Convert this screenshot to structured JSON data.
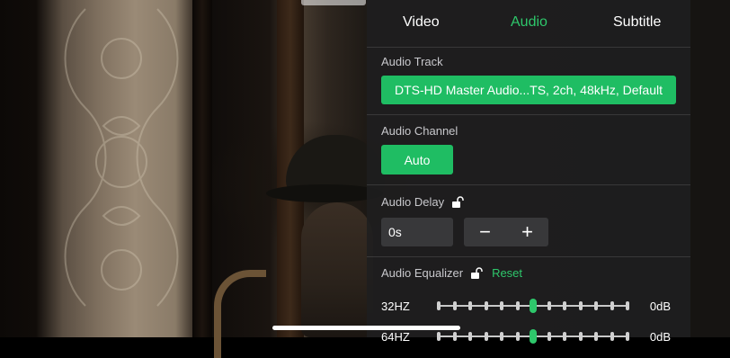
{
  "tabs": [
    {
      "label": "Video",
      "active": false
    },
    {
      "label": "Audio",
      "active": true
    },
    {
      "label": "Subtitle",
      "active": false
    }
  ],
  "audio_track": {
    "label": "Audio Track",
    "value": "DTS-HD Master Audio...TS, 2ch, 48kHz, Default"
  },
  "audio_channel": {
    "label": "Audio Channel",
    "value": "Auto"
  },
  "audio_delay": {
    "label": "Audio Delay",
    "value": "0s",
    "minus": "−",
    "plus": "+"
  },
  "equalizer": {
    "label": "Audio Equalizer",
    "reset": "Reset",
    "bands": [
      {
        "label": "32HZ",
        "value": "0dB",
        "level": 0.5
      },
      {
        "label": "64HZ",
        "value": "0dB",
        "level": 0.5
      }
    ]
  },
  "colors": {
    "accent": "#2ec76b",
    "button": "#1fbd63",
    "panel": "#1e1e20"
  },
  "icons": {
    "lock": "unlocked-padlock-icon"
  }
}
